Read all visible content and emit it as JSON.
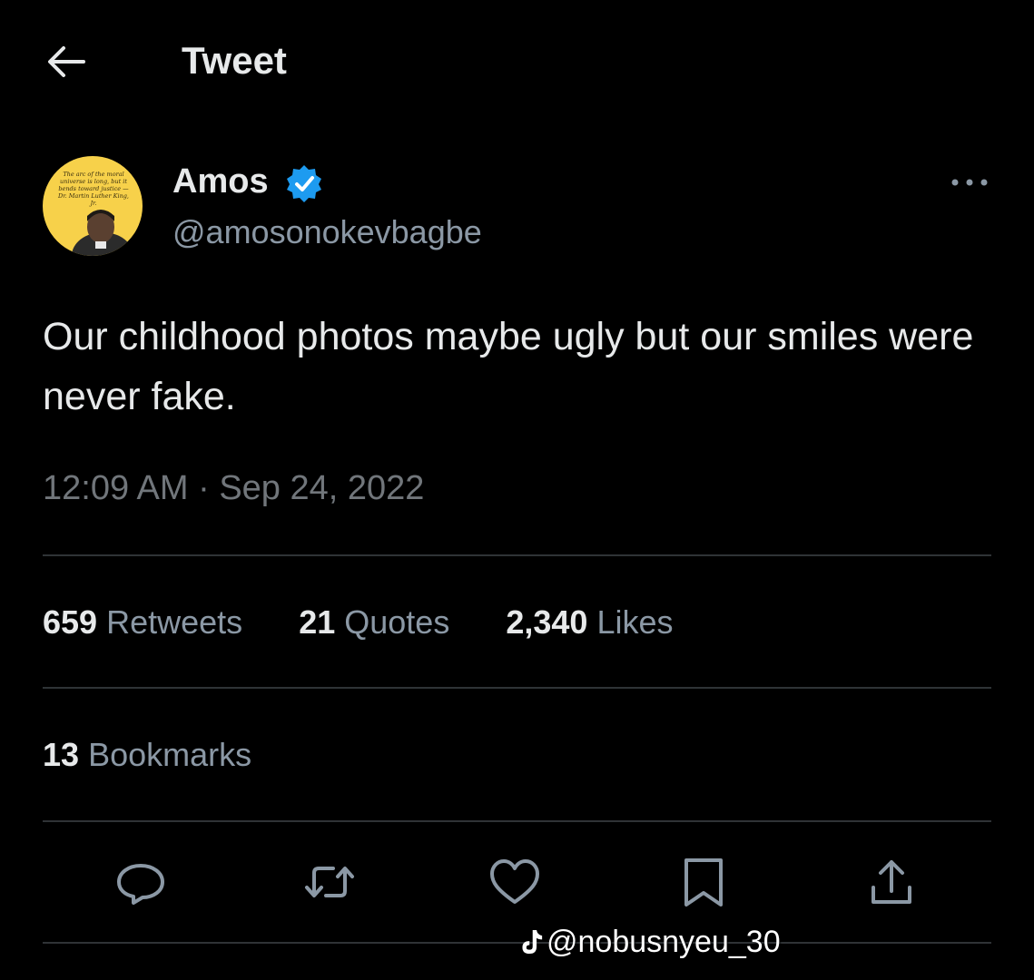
{
  "header": {
    "title": "Tweet",
    "back_icon": "arrow-left-icon"
  },
  "author": {
    "name": "Amos",
    "handle": "@amosonokevbagbe",
    "verified_icon": "verified-badge-icon",
    "verified_color": "#1d9bf0",
    "avatar_quote": "The arc of the moral universe is long, but it bends toward justice —Dr. Martin Luther King, Jr."
  },
  "tweet": {
    "text": "Our childhood photos maybe ugly but our smiles were never fake.",
    "timestamp": "12:09 AM · Sep 24, 2022"
  },
  "stats": [
    {
      "count": "659",
      "label": "Retweets"
    },
    {
      "count": "21",
      "label": "Quotes"
    },
    {
      "count": "2,340",
      "label": "Likes"
    }
  ],
  "bookmarks": {
    "count": "13",
    "label": "Bookmarks"
  },
  "actions": [
    "reply-icon",
    "retweet-icon",
    "like-icon",
    "bookmark-icon",
    "share-icon"
  ],
  "watermark": {
    "text": "@nobusnyeu_30",
    "icon": "tiktok-icon"
  },
  "colors": {
    "background": "#000000",
    "text": "#e7e9ea",
    "secondary": "#71767b",
    "divider": "#2f3336"
  }
}
